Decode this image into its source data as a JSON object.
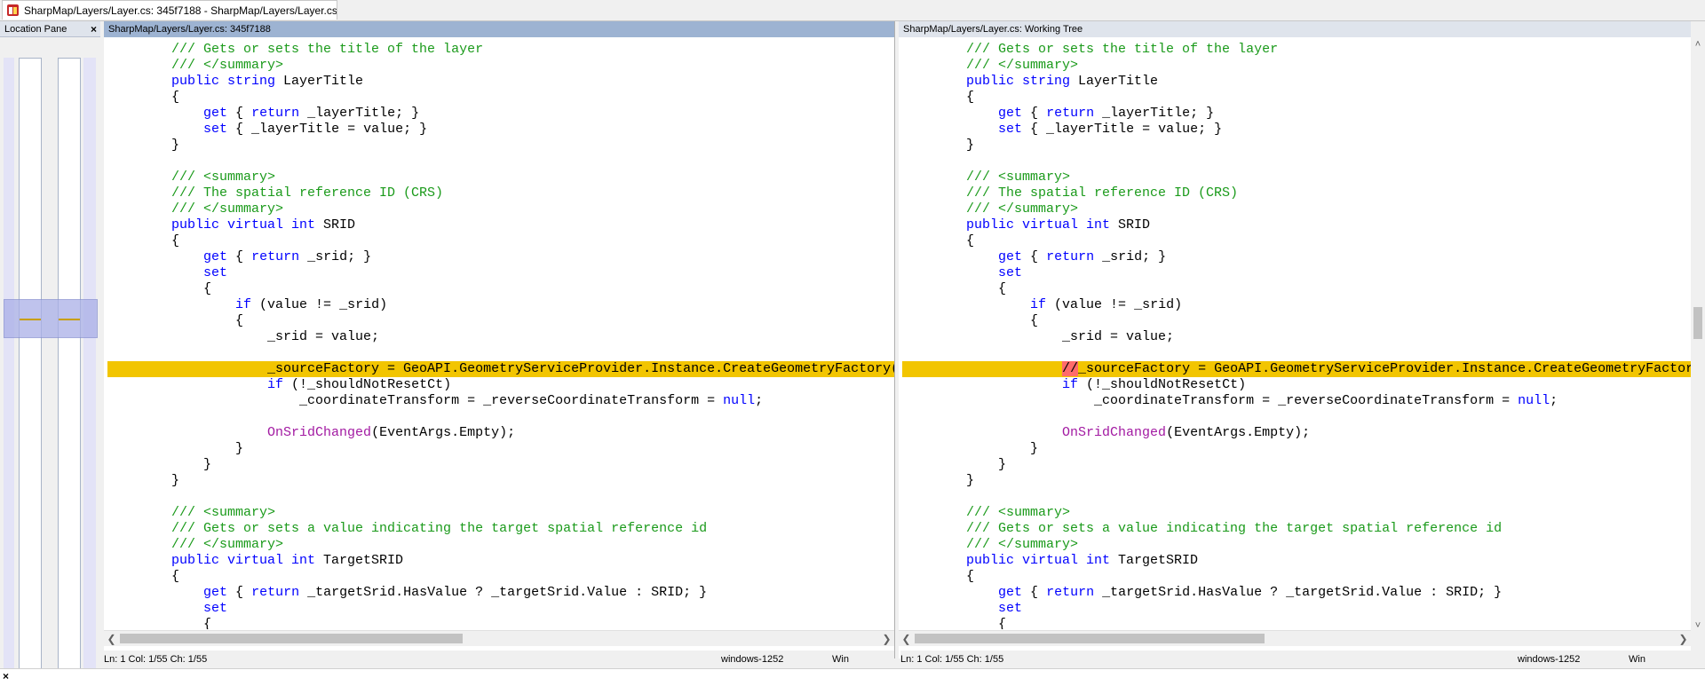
{
  "tab": {
    "title": "SharpMap/Layers/Layer.cs: 345f7188 - SharpMap/Layers/Layer.cs..."
  },
  "location_pane": {
    "title": "Location Pane",
    "close": "×"
  },
  "left_pane": {
    "header": "SharpMap/Layers/Layer.cs: 345f7188",
    "status": {
      "position": "Ln: 1  Col: 1/55  Ch: 1/55",
      "encoding": "windows-1252",
      "eol": "Win"
    }
  },
  "right_pane": {
    "header": "SharpMap/Layers/Layer.cs: Working Tree",
    "status": {
      "position": "Ln: 1  Col: 1/55  Ch: 1/55",
      "encoding": "windows-1252",
      "eol": "Win"
    }
  },
  "colors": {
    "changed_line": "#f2c500",
    "deleted_text": "#ff6b6b",
    "comment": "#1a9a1a",
    "keyword": "#0000ff",
    "method": "#a21aa2"
  },
  "code_left": [
    [
      [
        "c",
        "        /// Gets or sets the title of the layer"
      ]
    ],
    [
      [
        "c",
        "        /// </summary>"
      ]
    ],
    [
      [
        "k",
        "        public string "
      ],
      [
        "t",
        "LayerTitle"
      ]
    ],
    [
      [
        "t",
        "        {"
      ]
    ],
    [
      [
        "t",
        "            "
      ],
      [
        "k",
        "get"
      ],
      [
        "t",
        " { "
      ],
      [
        "k",
        "return"
      ],
      [
        "t",
        " _layerTitle; }"
      ]
    ],
    [
      [
        "t",
        "            "
      ],
      [
        "k",
        "set"
      ],
      [
        "t",
        " { _layerTitle = value; }"
      ]
    ],
    [
      [
        "t",
        "        }"
      ]
    ],
    [
      [
        "t",
        ""
      ]
    ],
    [
      [
        "c",
        "        /// <summary>"
      ]
    ],
    [
      [
        "c",
        "        /// The spatial reference ID (CRS)"
      ]
    ],
    [
      [
        "c",
        "        /// </summary>"
      ]
    ],
    [
      [
        "k",
        "        public virtual int "
      ],
      [
        "t",
        "SRID"
      ]
    ],
    [
      [
        "t",
        "        {"
      ]
    ],
    [
      [
        "t",
        "            "
      ],
      [
        "k",
        "get"
      ],
      [
        "t",
        " { "
      ],
      [
        "k",
        "return"
      ],
      [
        "t",
        " _srid; }"
      ]
    ],
    [
      [
        "k",
        "            set"
      ]
    ],
    [
      [
        "t",
        "            {"
      ]
    ],
    [
      [
        "t",
        "                "
      ],
      [
        "k",
        "if"
      ],
      [
        "t",
        " (value != _srid)"
      ]
    ],
    [
      [
        "t",
        "                {"
      ]
    ],
    [
      [
        "t",
        "                    _srid = value;"
      ]
    ],
    [
      [
        "t",
        ""
      ]
    ],
    [
      [
        "t",
        "                    _sourceFactory = GeoAPI.GeometryServiceProvider.Instance.CreateGeometryFactory(value);"
      ]
    ],
    [
      [
        "t",
        "                    "
      ],
      [
        "k",
        "if"
      ],
      [
        "t",
        " (!_shouldNotResetCt)"
      ]
    ],
    [
      [
        "t",
        "                        _coordinateTransform = _reverseCoordinateTransform = "
      ],
      [
        "k",
        "null"
      ],
      [
        "t",
        ";"
      ]
    ],
    [
      [
        "t",
        ""
      ]
    ],
    [
      [
        "t",
        "                    "
      ],
      [
        "f",
        "OnSridChanged"
      ],
      [
        "t",
        "(EventArgs.Empty);"
      ]
    ],
    [
      [
        "t",
        "                }"
      ]
    ],
    [
      [
        "t",
        "            }"
      ]
    ],
    [
      [
        "t",
        "        }"
      ]
    ],
    [
      [
        "t",
        ""
      ]
    ],
    [
      [
        "c",
        "        /// <summary>"
      ]
    ],
    [
      [
        "c",
        "        /// Gets or sets a value indicating the target spatial reference id"
      ]
    ],
    [
      [
        "c",
        "        /// </summary>"
      ]
    ],
    [
      [
        "k",
        "        public virtual int "
      ],
      [
        "t",
        "TargetSRID"
      ]
    ],
    [
      [
        "t",
        "        {"
      ]
    ],
    [
      [
        "t",
        "            "
      ],
      [
        "k",
        "get"
      ],
      [
        "t",
        " { "
      ],
      [
        "k",
        "return"
      ],
      [
        "t",
        " _targetSrid.HasValue ? _targetSrid.Value : SRID; }"
      ]
    ],
    [
      [
        "k",
        "            set"
      ]
    ],
    [
      [
        "t",
        "            {"
      ]
    ]
  ],
  "code_right": [
    [
      [
        "c",
        "        /// Gets or sets the title of the layer"
      ]
    ],
    [
      [
        "c",
        "        /// </summary>"
      ]
    ],
    [
      [
        "k",
        "        public string "
      ],
      [
        "t",
        "LayerTitle"
      ]
    ],
    [
      [
        "t",
        "        {"
      ]
    ],
    [
      [
        "t",
        "            "
      ],
      [
        "k",
        "get"
      ],
      [
        "t",
        " { "
      ],
      [
        "k",
        "return"
      ],
      [
        "t",
        " _layerTitle; }"
      ]
    ],
    [
      [
        "t",
        "            "
      ],
      [
        "k",
        "set"
      ],
      [
        "t",
        " { _layerTitle = value; }"
      ]
    ],
    [
      [
        "t",
        "        }"
      ]
    ],
    [
      [
        "t",
        ""
      ]
    ],
    [
      [
        "c",
        "        /// <summary>"
      ]
    ],
    [
      [
        "c",
        "        /// The spatial reference ID (CRS)"
      ]
    ],
    [
      [
        "c",
        "        /// </summary>"
      ]
    ],
    [
      [
        "k",
        "        public virtual int "
      ],
      [
        "t",
        "SRID"
      ]
    ],
    [
      [
        "t",
        "        {"
      ]
    ],
    [
      [
        "t",
        "            "
      ],
      [
        "k",
        "get"
      ],
      [
        "t",
        " { "
      ],
      [
        "k",
        "return"
      ],
      [
        "t",
        " _srid; }"
      ]
    ],
    [
      [
        "k",
        "            set"
      ]
    ],
    [
      [
        "t",
        "            {"
      ]
    ],
    [
      [
        "t",
        "                "
      ],
      [
        "k",
        "if"
      ],
      [
        "t",
        " (value != _srid)"
      ]
    ],
    [
      [
        "t",
        "                {"
      ]
    ],
    [
      [
        "t",
        "                    _srid = value;"
      ]
    ],
    [
      [
        "t",
        ""
      ]
    ],
    [
      [
        "t",
        "                    "
      ],
      [
        "d",
        "//"
      ],
      [
        "t",
        "_sourceFactory = GeoAPI.GeometryServiceProvider.Instance.CreateGeometryFactory(value);"
      ]
    ],
    [
      [
        "t",
        "                    "
      ],
      [
        "k",
        "if"
      ],
      [
        "t",
        " (!_shouldNotResetCt)"
      ]
    ],
    [
      [
        "t",
        "                        _coordinateTransform = _reverseCoordinateTransform = "
      ],
      [
        "k",
        "null"
      ],
      [
        "t",
        ";"
      ]
    ],
    [
      [
        "t",
        ""
      ]
    ],
    [
      [
        "t",
        "                    "
      ],
      [
        "f",
        "OnSridChanged"
      ],
      [
        "t",
        "(EventArgs.Empty);"
      ]
    ],
    [
      [
        "t",
        "                }"
      ]
    ],
    [
      [
        "t",
        "            }"
      ]
    ],
    [
      [
        "t",
        "        }"
      ]
    ],
    [
      [
        "t",
        ""
      ]
    ],
    [
      [
        "c",
        "        /// <summary>"
      ]
    ],
    [
      [
        "c",
        "        /// Gets or sets a value indicating the target spatial reference id"
      ]
    ],
    [
      [
        "c",
        "        /// </summary>"
      ]
    ],
    [
      [
        "k",
        "        public virtual int "
      ],
      [
        "t",
        "TargetSRID"
      ]
    ],
    [
      [
        "t",
        "        {"
      ]
    ],
    [
      [
        "t",
        "            "
      ],
      [
        "k",
        "get"
      ],
      [
        "t",
        " { "
      ],
      [
        "k",
        "return"
      ],
      [
        "t",
        " _targetSrid.HasValue ? _targetSrid.Value : SRID; }"
      ]
    ],
    [
      [
        "k",
        "            set"
      ]
    ],
    [
      [
        "t",
        "            {"
      ]
    ]
  ],
  "changed_line_index": 20,
  "bottom": {
    "close": "×"
  }
}
